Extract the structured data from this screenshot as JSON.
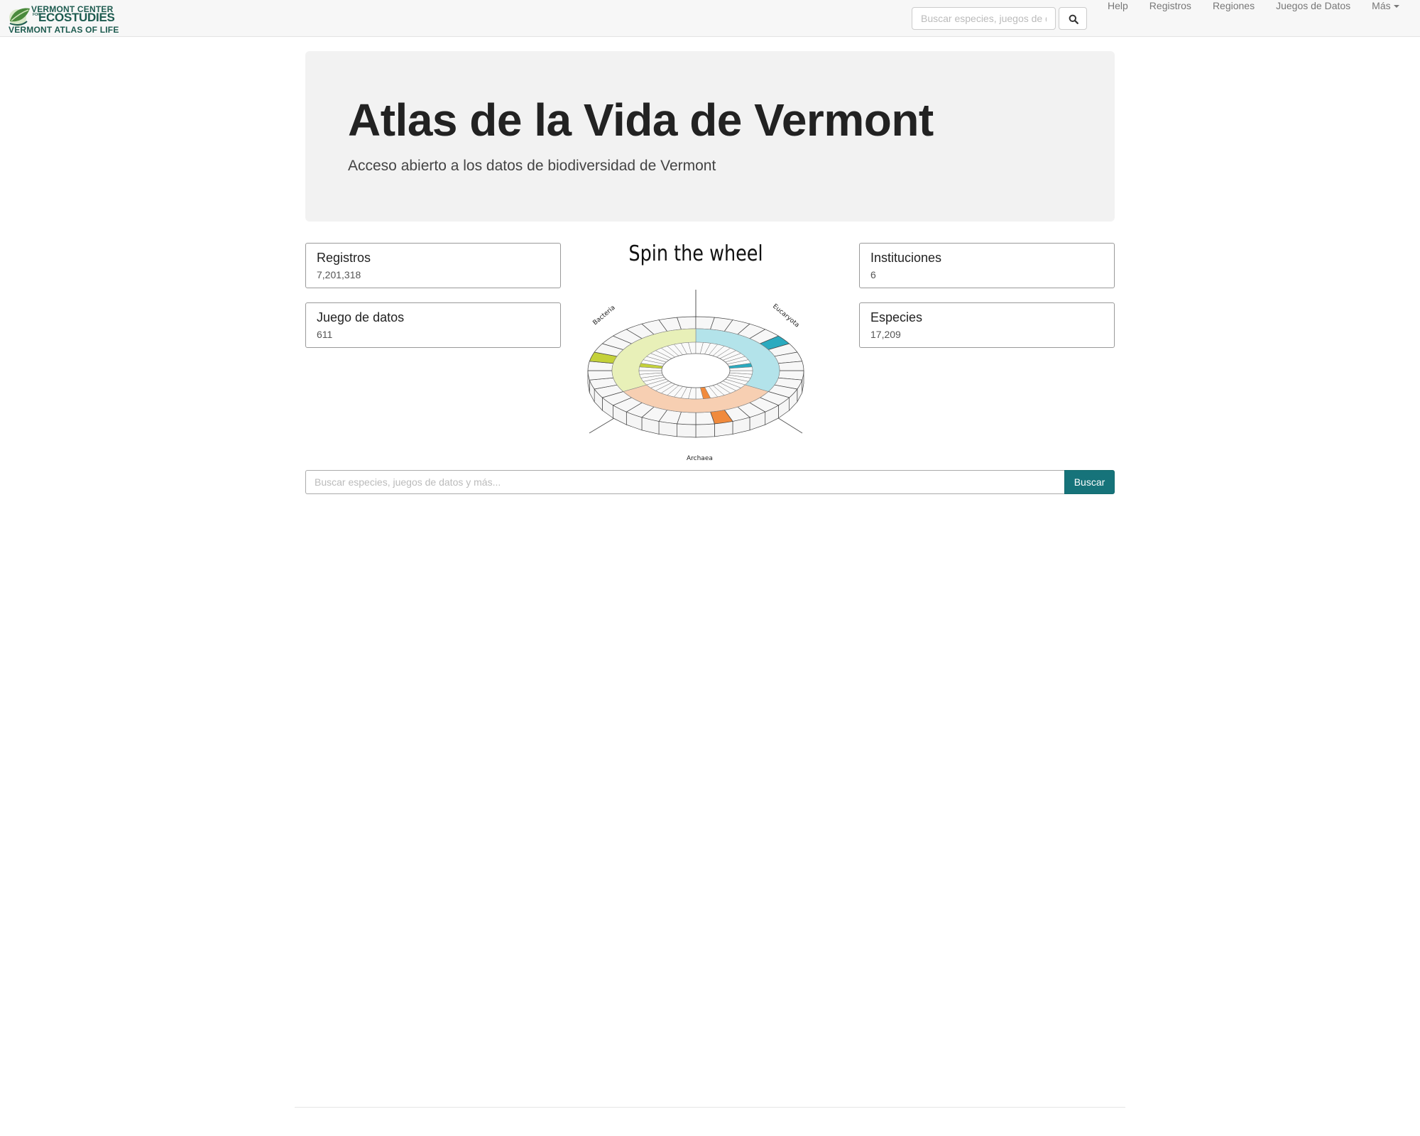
{
  "brand": {
    "line1": "VERMONT CENTER",
    "for": "FOR",
    "line2": "ECOSTUDIES",
    "line3": "VERMONT ATLAS OF LIFE",
    "color": "#1d5b4f"
  },
  "navbar": {
    "search_placeholder": "Buscar especies, juegos de datos y más...",
    "search_icon": "search-icon",
    "links": [
      "Help",
      "Registros",
      "Regiones",
      "Juegos de Datos"
    ],
    "more_label": "Más"
  },
  "hero": {
    "title": "Atlas de la Vida de Vermont",
    "subtitle": "Acceso abierto a los datos de biodiversidad de Vermont"
  },
  "stats": {
    "records": {
      "label": "Registros",
      "value": "7,201,318"
    },
    "datasets": {
      "label": "Juego de datos",
      "value": "611"
    },
    "institutions": {
      "label": "Instituciones",
      "value": "6"
    },
    "species": {
      "label": "Especies",
      "value": "17,209"
    }
  },
  "wheel": {
    "title": "Spin the wheel",
    "labels": {
      "bacteria": "Bacteria",
      "eucaryota": "Eucaryota",
      "archaea": "Archaea"
    },
    "colors": {
      "bacteria": "#e8f0b8",
      "bacteria_accent": "#c4d13a",
      "eucaryota": "#b3e3ea",
      "eucaryota_accent": "#2aaabf",
      "archaea": "#f7cfb2",
      "archaea_accent": "#f08a3c"
    }
  },
  "search": {
    "placeholder": "Buscar especies, juegos de datos y más...",
    "button_label": "Buscar",
    "accent": "#16737a"
  }
}
